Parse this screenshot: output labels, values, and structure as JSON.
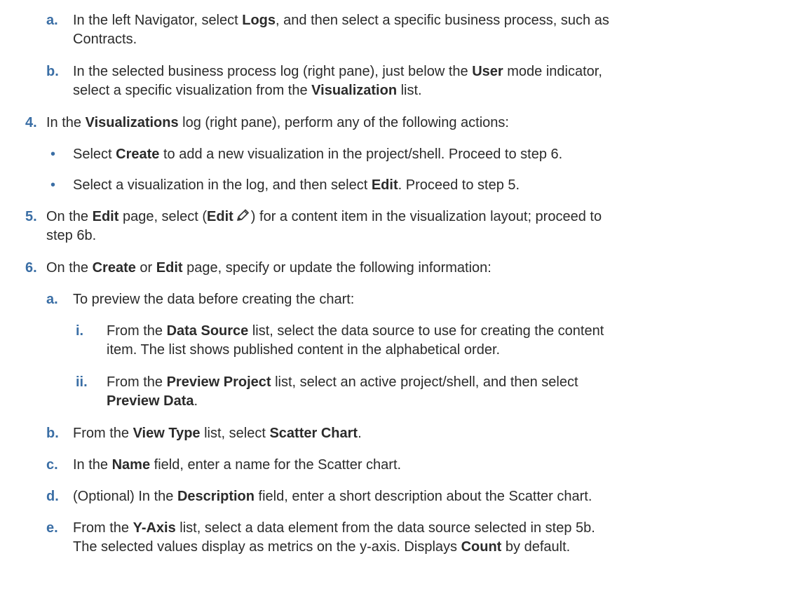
{
  "steps": {
    "a1": {
      "marker": "a.",
      "t1": "In the left Navigator, select ",
      "b1": "Logs",
      "t2": ", and then select a specific business process, such as",
      "line2": "Contracts."
    },
    "b1": {
      "marker": "b.",
      "t1": "In the selected business process log (right pane), just below the ",
      "b1": "User",
      "t2": " mode indicator,",
      "line2a": "select a specific visualization from the ",
      "b2": "Visualization",
      "line2b": " list."
    },
    "s4": {
      "marker": "4.",
      "t1": "In the ",
      "b1": "Visualizations",
      "t2": " log (right pane), perform any of the following actions:"
    },
    "bul1": {
      "marker": "•",
      "t1": "Select ",
      "b1": "Create",
      "t2": " to add a new visualization in the project/shell. Proceed to step 6."
    },
    "bul2": {
      "marker": "•",
      "t1": "Select a visualization in the log, and then select ",
      "b1": "Edit",
      "t2": ". Proceed to step 5."
    },
    "s5": {
      "marker": "5.",
      "t1": "On the ",
      "b1": "Edit",
      "t2": " page, select (",
      "b2": "Edit",
      "t3": ") for a content item in the visualization layout; proceed to",
      "line2": "step 6b.",
      "icon": "pencil-icon"
    },
    "s6": {
      "marker": "6.",
      "t1": "On the ",
      "b1": "Create",
      "t2": " or ",
      "b2": "Edit",
      "t3": " page, specify or update the following information:"
    },
    "a6": {
      "marker": "a.",
      "t1": "To preview the data before creating the chart:"
    },
    "i6": {
      "marker": "i.",
      "t1": "From the ",
      "b1": "Data Source",
      "t2": " list, select the data source to use for creating the content",
      "line2": "item. The list shows published content in the alphabetical order."
    },
    "ii6": {
      "marker": "ii.",
      "t1": "From the ",
      "b1": "Preview Project",
      "t2": " list, select an active project/shell, and then select",
      "b2": "Preview Data",
      "t3": "."
    },
    "b6": {
      "marker": "b.",
      "t1": "From the ",
      "b1": "View Type",
      "t2": " list, select ",
      "b2": "Scatter Chart",
      "t3": "."
    },
    "c6": {
      "marker": "c.",
      "t1": "In the ",
      "b1": "Name",
      "t2": " field, enter a name for the Scatter chart."
    },
    "d6": {
      "marker": "d.",
      "t1": "(Optional) In the ",
      "b1": "Description",
      "t2": " field, enter a short description about the Scatter chart."
    },
    "e6": {
      "marker": "e.",
      "t1": "From the ",
      "b1": "Y-Axis",
      "t2": " list, select a data element from the data source selected in step 5b.",
      "line2a": "The selected values display as metrics on the y-axis. Displays ",
      "b2": "Count",
      "line2b": " by default."
    }
  }
}
